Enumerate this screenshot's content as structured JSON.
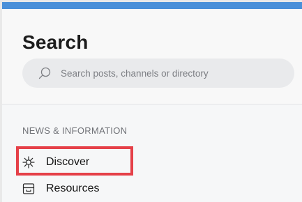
{
  "header": {
    "title": "Search"
  },
  "search": {
    "placeholder": "Search posts, channels or directory",
    "icon": "search-icon"
  },
  "sections": {
    "news_label": "NEWS & INFORMATION",
    "items": [
      {
        "label": "Discover",
        "icon": "discover-icon"
      },
      {
        "label": "Resources",
        "icon": "resources-icon"
      }
    ]
  },
  "colors": {
    "accent": "#4a90d9",
    "highlight": "#e54048"
  }
}
